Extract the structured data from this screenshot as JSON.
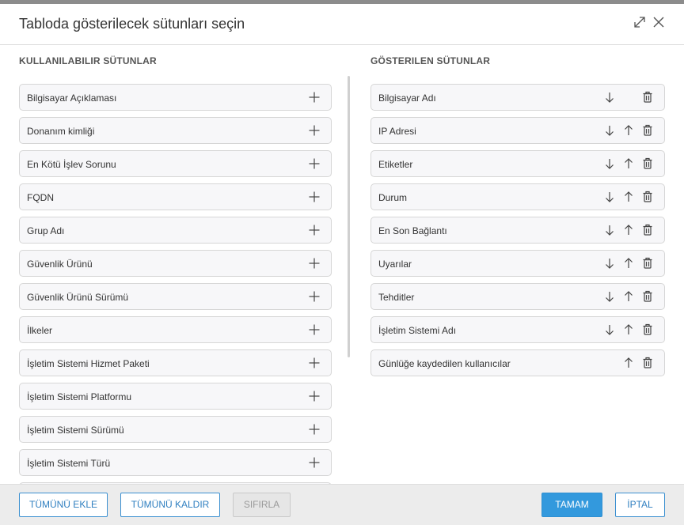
{
  "dialog": {
    "title": "Tabloda gösterilecek sütunları seçin",
    "accent_color": "#3399dd"
  },
  "available": {
    "heading": "KULLANILABILIR SÜTUNLAR",
    "items": [
      "Bilgisayar Açıklaması",
      "Donanım kimliği",
      "En Kötü İşlev Sorunu",
      "FQDN",
      "Grup Adı",
      "Güvenlik Ürünü",
      "Güvenlik Ürünü Sürümü",
      "İlkeler",
      "İşletim Sistemi Hizmet Paketi",
      "İşletim Sistemi Platformu",
      "İşletim Sistemi Sürümü",
      "İşletim Sistemi Türü"
    ]
  },
  "shown": {
    "heading": "GÖSTERILEN SÜTUNLAR",
    "items": [
      "Bilgisayar Adı",
      "IP Adresi",
      "Etiketler",
      "Durum",
      "En Son Bağlantı",
      "Uyarılar",
      "Tehditler",
      "İşletim Sistemi Adı",
      "Günlüğe kaydedilen kullanıcılar"
    ]
  },
  "footer": {
    "add_all": "TÜMÜNÜ EKLE",
    "remove_all": "TÜMÜNÜ KALDIR",
    "reset": "SIFIRLA",
    "ok": "TAMAM",
    "cancel": "İPTAL"
  },
  "icons": {
    "expand": "expand-icon",
    "close": "close-icon",
    "add": "plus-icon",
    "move_down": "arrow-down-icon",
    "move_up": "arrow-up-icon",
    "remove": "trash-icon"
  }
}
